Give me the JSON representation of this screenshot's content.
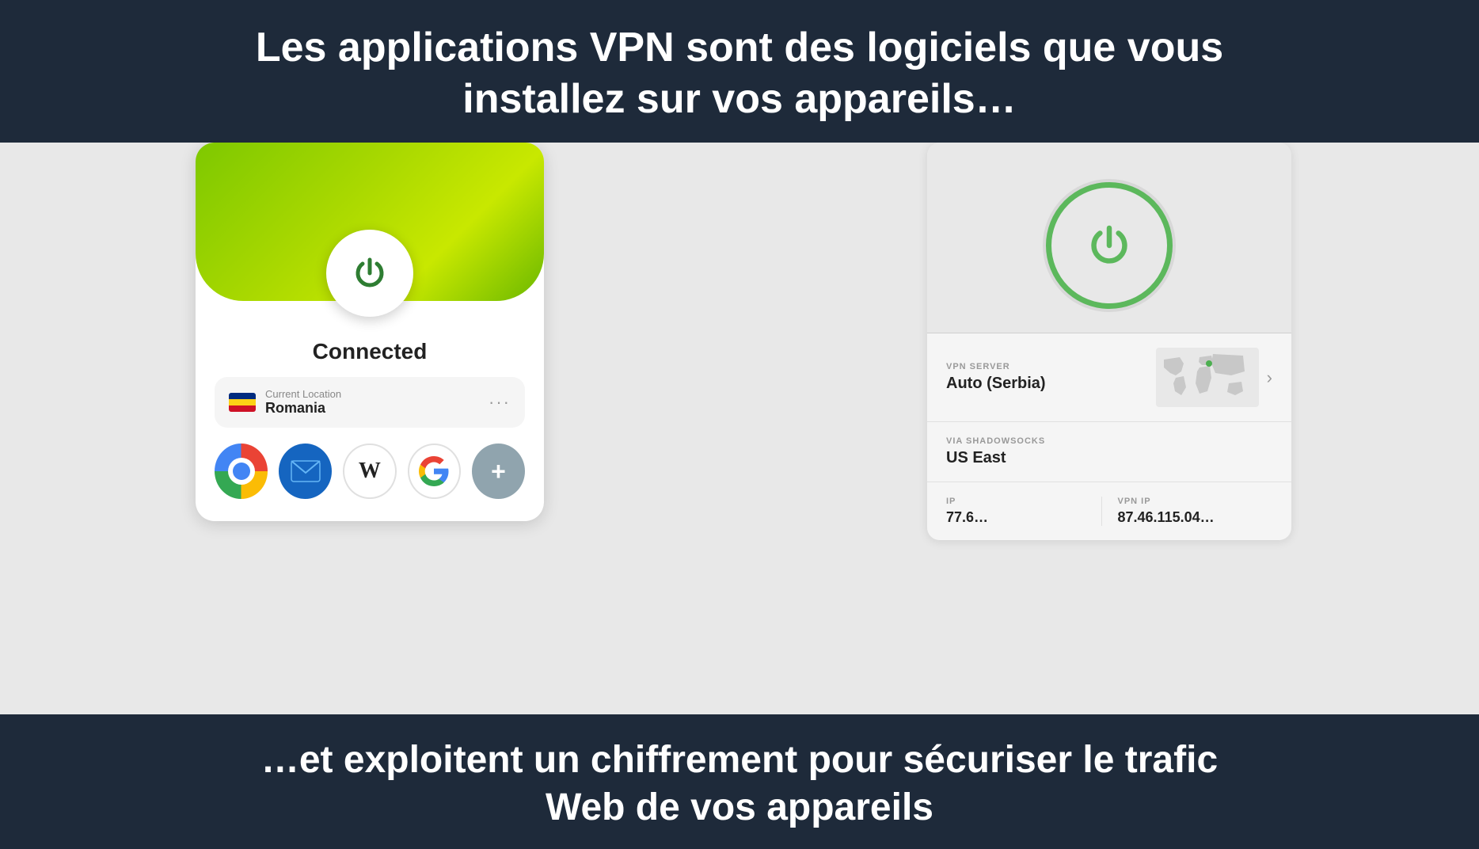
{
  "top_banner": {
    "line1": "Les applications VPN sont des logiciels que vous",
    "line2": "installez sur vos appareils…"
  },
  "bottom_banner": {
    "line1": "…et exploitent un chiffrement pour sécuriser le trafic",
    "line2": "Web de vos appareils"
  },
  "left_vpn": {
    "status": "Connected",
    "location_label": "Current Location",
    "location_name": "Romania",
    "more_options": "···",
    "apps": [
      {
        "name": "Chrome",
        "type": "chrome"
      },
      {
        "name": "Mail",
        "type": "mail"
      },
      {
        "name": "Wikipedia",
        "type": "wikipedia"
      },
      {
        "name": "Google",
        "type": "google"
      },
      {
        "name": "Add",
        "type": "plus"
      }
    ]
  },
  "right_vpn": {
    "vpn_server_label": "VPN SERVER",
    "vpn_server_value": "Auto (Serbia)",
    "shadowsocks_label": "VIA SHADOWSOCKS",
    "shadowsocks_value": "US East",
    "ip_label": "IP",
    "ip_value": "77.6…",
    "vpn_ip_label": "VPN IP",
    "vpn_ip_value": "87.46.115.04…"
  }
}
